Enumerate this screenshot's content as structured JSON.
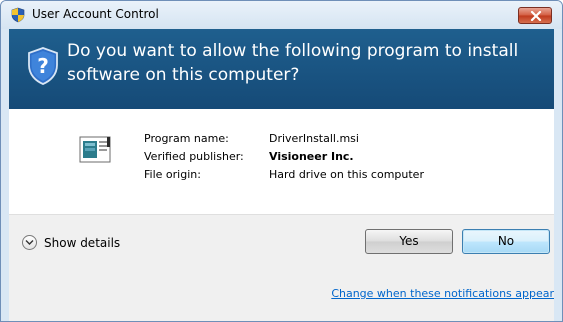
{
  "window": {
    "title": "User Account Control",
    "icons": {
      "title": "uac-shield-icon",
      "close": "close-icon"
    }
  },
  "banner": {
    "question": "Do you want to allow the following program to install software on this computer?",
    "icon": "question-shield-icon"
  },
  "details": {
    "program_icon": "installer-package-icon",
    "rows": [
      {
        "key": "Program name:",
        "value": "DriverInstall.msi"
      },
      {
        "key": "Verified publisher:",
        "value": "Visioneer Inc."
      },
      {
        "key": "File origin:",
        "value": "Hard drive on this computer"
      }
    ]
  },
  "footer": {
    "show_details": "Show details",
    "yes_label": "Yes",
    "no_label": "No"
  },
  "link": {
    "change_notifications": "Change when these notifications appear"
  },
  "colors": {
    "banner": "#1a5484",
    "link": "#0066cc",
    "close_button": "#c74a2e"
  }
}
